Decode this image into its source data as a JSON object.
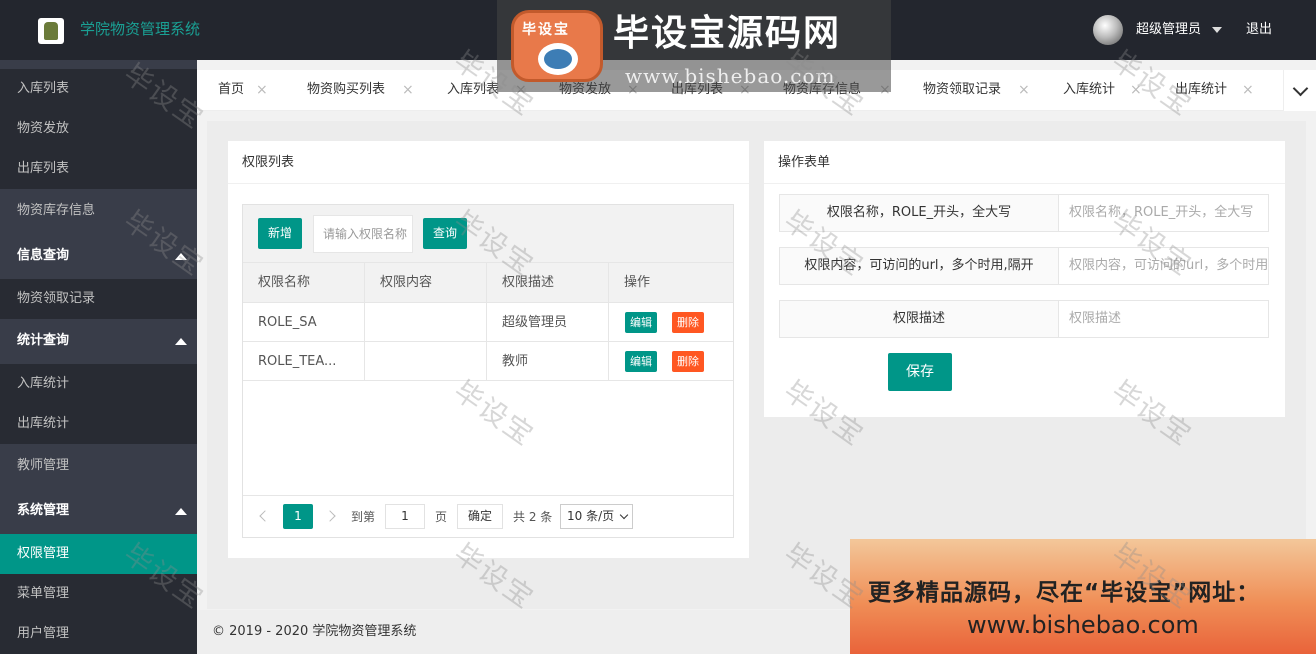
{
  "header": {
    "app_title": "学院物资管理系统",
    "user_name": "超级管理员",
    "logout": "退出"
  },
  "watermark_banner": {
    "logo_text": "毕设宝",
    "title": "毕设宝源码网",
    "url": "www.bishebao.com"
  },
  "watermark_text": "毕设宝",
  "sidebar": {
    "items": [
      {
        "label": "入库列表"
      },
      {
        "label": "物资发放"
      },
      {
        "label": "出库列表"
      },
      {
        "label": "物资库存信息"
      },
      {
        "label": "信息查询"
      },
      {
        "label": "物资领取记录"
      },
      {
        "label": "统计查询"
      },
      {
        "label": "入库统计"
      },
      {
        "label": "出库统计"
      },
      {
        "label": "教师管理"
      },
      {
        "label": "系统管理"
      },
      {
        "label": "权限管理"
      },
      {
        "label": "菜单管理"
      },
      {
        "label": "用户管理"
      }
    ]
  },
  "tabs": [
    {
      "label": "首页"
    },
    {
      "label": "物资购买列表"
    },
    {
      "label": "入库列表"
    },
    {
      "label": "物资发放"
    },
    {
      "label": "出库列表"
    },
    {
      "label": "物资库存信息"
    },
    {
      "label": "物资领取记录"
    },
    {
      "label": "入库统计"
    },
    {
      "label": "出库统计"
    }
  ],
  "tab_close": "×",
  "permission_list": {
    "title": "权限列表",
    "add_button": "新增",
    "search_placeholder": "请输入权限名称",
    "query_button": "查询",
    "columns": [
      "权限名称",
      "权限内容",
      "权限描述",
      "操作"
    ],
    "rows": [
      {
        "name": "ROLE_SA",
        "content": "",
        "description": "超级管理员"
      },
      {
        "name": "ROLE_TEA...",
        "content": "",
        "description": "教师"
      }
    ],
    "edit_label": "编辑",
    "delete_label": "删除",
    "pager": {
      "current_page": "1",
      "goto_label": "到第",
      "goto_value": "1",
      "page_label": "页",
      "confirm_label": "确定",
      "total_label": "共 2 条",
      "page_size": "10 条/页"
    }
  },
  "operation_form": {
    "title": "操作表单",
    "fields": [
      {
        "label": "权限名称，ROLE_开头，全大写",
        "placeholder": "权限名称，ROLE_开头，全大写"
      },
      {
        "label": "权限内容，可访问的url，多个时用,隔开",
        "placeholder": "权限内容，可访问的url，多个时用,隔开"
      },
      {
        "label": "权限描述",
        "placeholder": "权限描述"
      }
    ],
    "save_button": "保存"
  },
  "footer": {
    "copyright": "© 2019 - 2020 学院物资管理系统"
  },
  "ad": {
    "line1": "更多精品源码，尽在“毕设宝”网址：",
    "line2": "www.bishebao.com"
  },
  "colors": {
    "accent": "#009688",
    "danger": "#ff5722",
    "sidebar_bg": "#393d49",
    "header_bg": "#23262e"
  }
}
